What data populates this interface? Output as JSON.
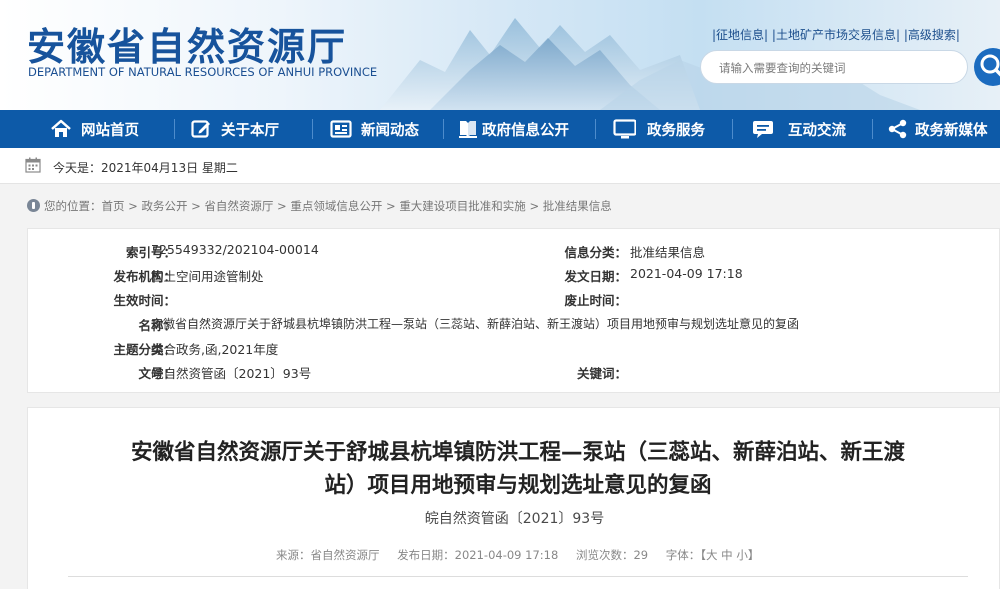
{
  "header": {
    "title": "安徽省自然资源厅",
    "subtitle": "DEPARTMENT OF NATURAL RESOURCES OF ANHUI PROVINCE",
    "links": [
      "|征地信息|",
      "|土地矿产市场交易信息|",
      "|高级搜索|"
    ],
    "search_placeholder": "请输入需要查询的关键词",
    "search_icon": "search-icon"
  },
  "nav": {
    "items": [
      {
        "label": "网站首页",
        "icon": "home-icon"
      },
      {
        "label": "关于本厅",
        "icon": "edit-icon"
      },
      {
        "label": "新闻动态",
        "icon": "news-icon"
      },
      {
        "label": "政府信息公开",
        "icon": "book-icon"
      },
      {
        "label": "政务服务",
        "icon": "monitor-icon"
      },
      {
        "label": "互动交流",
        "icon": "chat-icon"
      },
      {
        "label": "政务新媒体",
        "icon": "share-icon"
      }
    ]
  },
  "datebar": {
    "text": "今天是：2021年04月13日 星期二"
  },
  "breadcrumb": {
    "prefix": "您的位置：",
    "items": [
      "首页",
      "政务公开",
      "省自然资源厅",
      "重点领域信息公开",
      "重大建设项目批准和实施",
      "批准结果信息"
    ],
    "separator": " > "
  },
  "info": {
    "index_label": "索引号：",
    "index_value": "725549332/202104-00014",
    "category_label": "信息分类：",
    "category_value": "批准结果信息",
    "publisher_label": "发布机构：",
    "publisher_value": "国土空间用途管制处",
    "date_label": "发文日期：",
    "date_value": "2021-04-09 17:18",
    "effective_label": "生效时间：",
    "effective_value": "",
    "expire_label": "废止时间：",
    "expire_value": "",
    "name_label": "名称：",
    "name_value": "安徽省自然资源厅关于舒城县杭埠镇防洪工程—泵站（三蕊站、新薛泊站、新王渡站）项目用地预审与规划选址意见的复函",
    "topic_label": "主题分类：",
    "topic_value": "综合政务,函,2021年度",
    "docno_label": "文号：",
    "docno_value": "皖自然资管函〔2021〕93号",
    "keywords_label": "关键词：",
    "keywords_value": ""
  },
  "article": {
    "title_line1": "安徽省自然资源厅关于舒城县杭埠镇防洪工程—泵站（三蕊站、新薛泊站、新王渡",
    "title_line2": "站）项目用地预审与规划选址意见的复函",
    "doc_no": "皖自然资管函〔2021〕93号",
    "source": "来源：省自然资源厅",
    "published": "发布日期：2021-04-09 17:18",
    "views": "浏览次数：29",
    "font_label": "字体：",
    "font_open": "【",
    "font_large": "大",
    "font_medium": "中",
    "font_small": "小",
    "font_close": "】"
  },
  "colors": {
    "nav_bg": "#0d5aa8",
    "title_blue": "#17539c"
  }
}
